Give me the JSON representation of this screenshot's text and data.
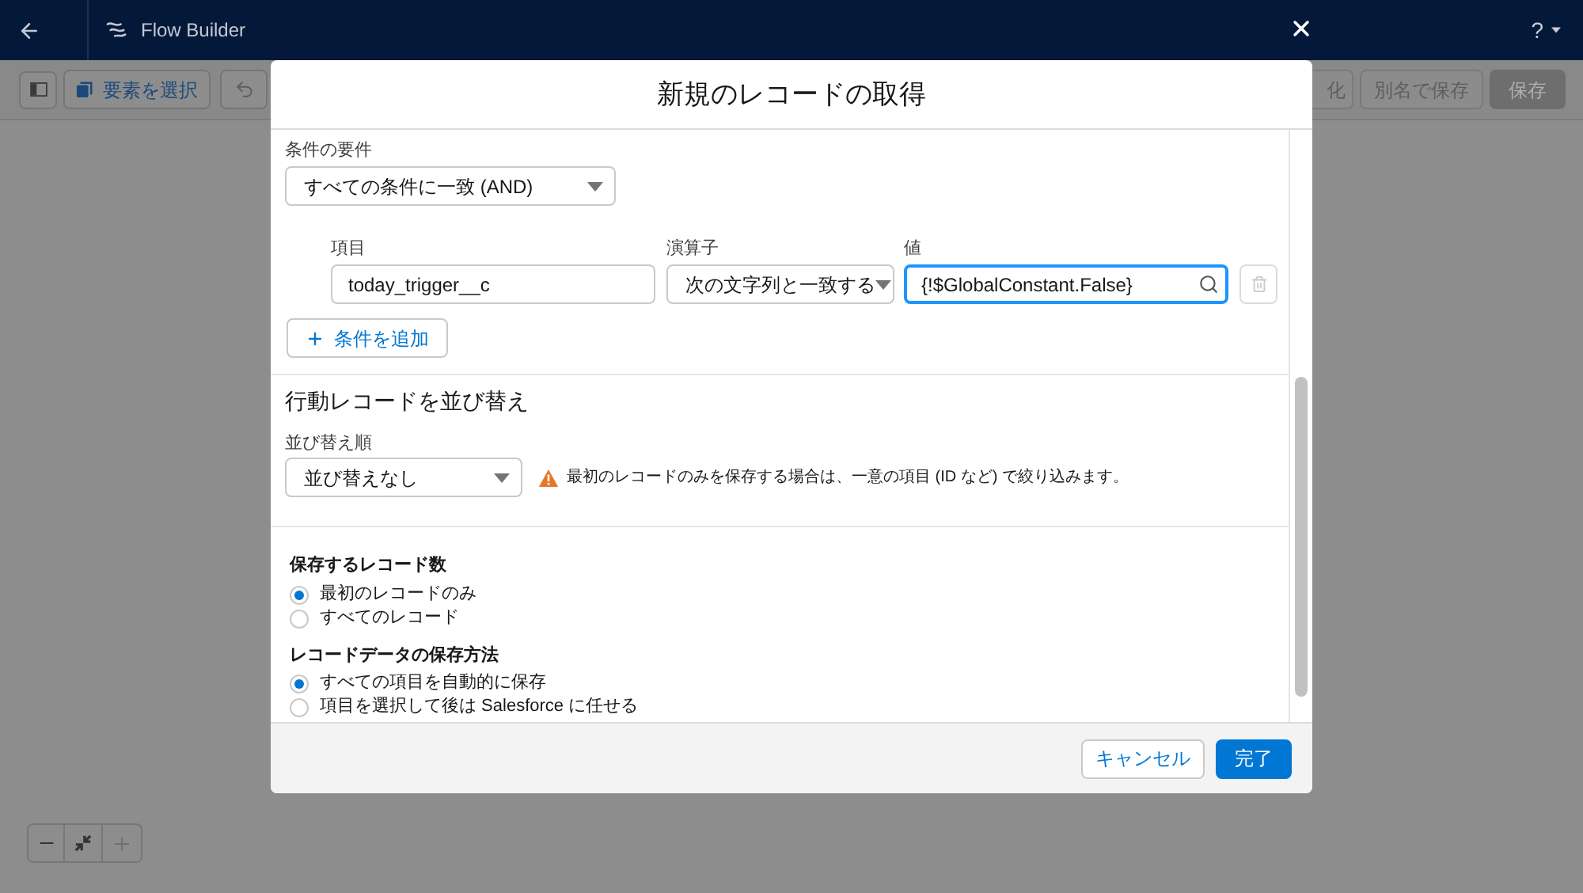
{
  "app_header": {
    "title": "Flow Builder",
    "help": "?"
  },
  "toolbar": {
    "select_elements": "要素を選択",
    "right_buttons": [
      {
        "label": "化",
        "kind": "neutral"
      },
      {
        "label": "別名で保存",
        "kind": "neutral"
      },
      {
        "label": "保存",
        "kind": "brand"
      }
    ]
  },
  "modal": {
    "title": "新規のレコードの取得",
    "condition_requirement": {
      "label": "条件の要件",
      "value": "すべての条件に一致 (AND)"
    },
    "conditions": {
      "columns": [
        "項目",
        "演算子",
        "値"
      ],
      "rows": [
        {
          "field": "today_trigger__c",
          "operator": "次の文字列と一致する",
          "value": "{!$GlobalConstant.False}",
          "value_focused": true,
          "delete_disabled": true
        }
      ]
    },
    "add_condition": "条件を追加",
    "sort": {
      "heading": "行動レコードを並び替え",
      "label": "並び替え順",
      "value": "並び替えなし",
      "warning": "最初のレコードのみを保存する場合は、一意の項目 (ID など) で絞り込みます。"
    },
    "record_count": {
      "label": "保存するレコード数",
      "options": [
        {
          "label": "最初のレコードのみ",
          "selected": true
        },
        {
          "label": "すべてのレコード",
          "selected": false
        }
      ]
    },
    "storage": {
      "label": "レコードデータの保存方法",
      "options": [
        {
          "label": "すべての項目を自動的に保存",
          "selected": true
        },
        {
          "label": "項目を選択して後は Salesforce に任せる",
          "selected": false
        }
      ]
    },
    "buttons": [
      {
        "label": "キャンセル",
        "kind": "neutral"
      },
      {
        "label": "完了",
        "kind": "brand"
      }
    ]
  },
  "zoom_controls": [
    {
      "kind": "zoom_out",
      "disabled": false
    },
    {
      "kind": "fit",
      "disabled": false
    },
    {
      "kind": "zoom_in",
      "disabled": true
    }
  ]
}
